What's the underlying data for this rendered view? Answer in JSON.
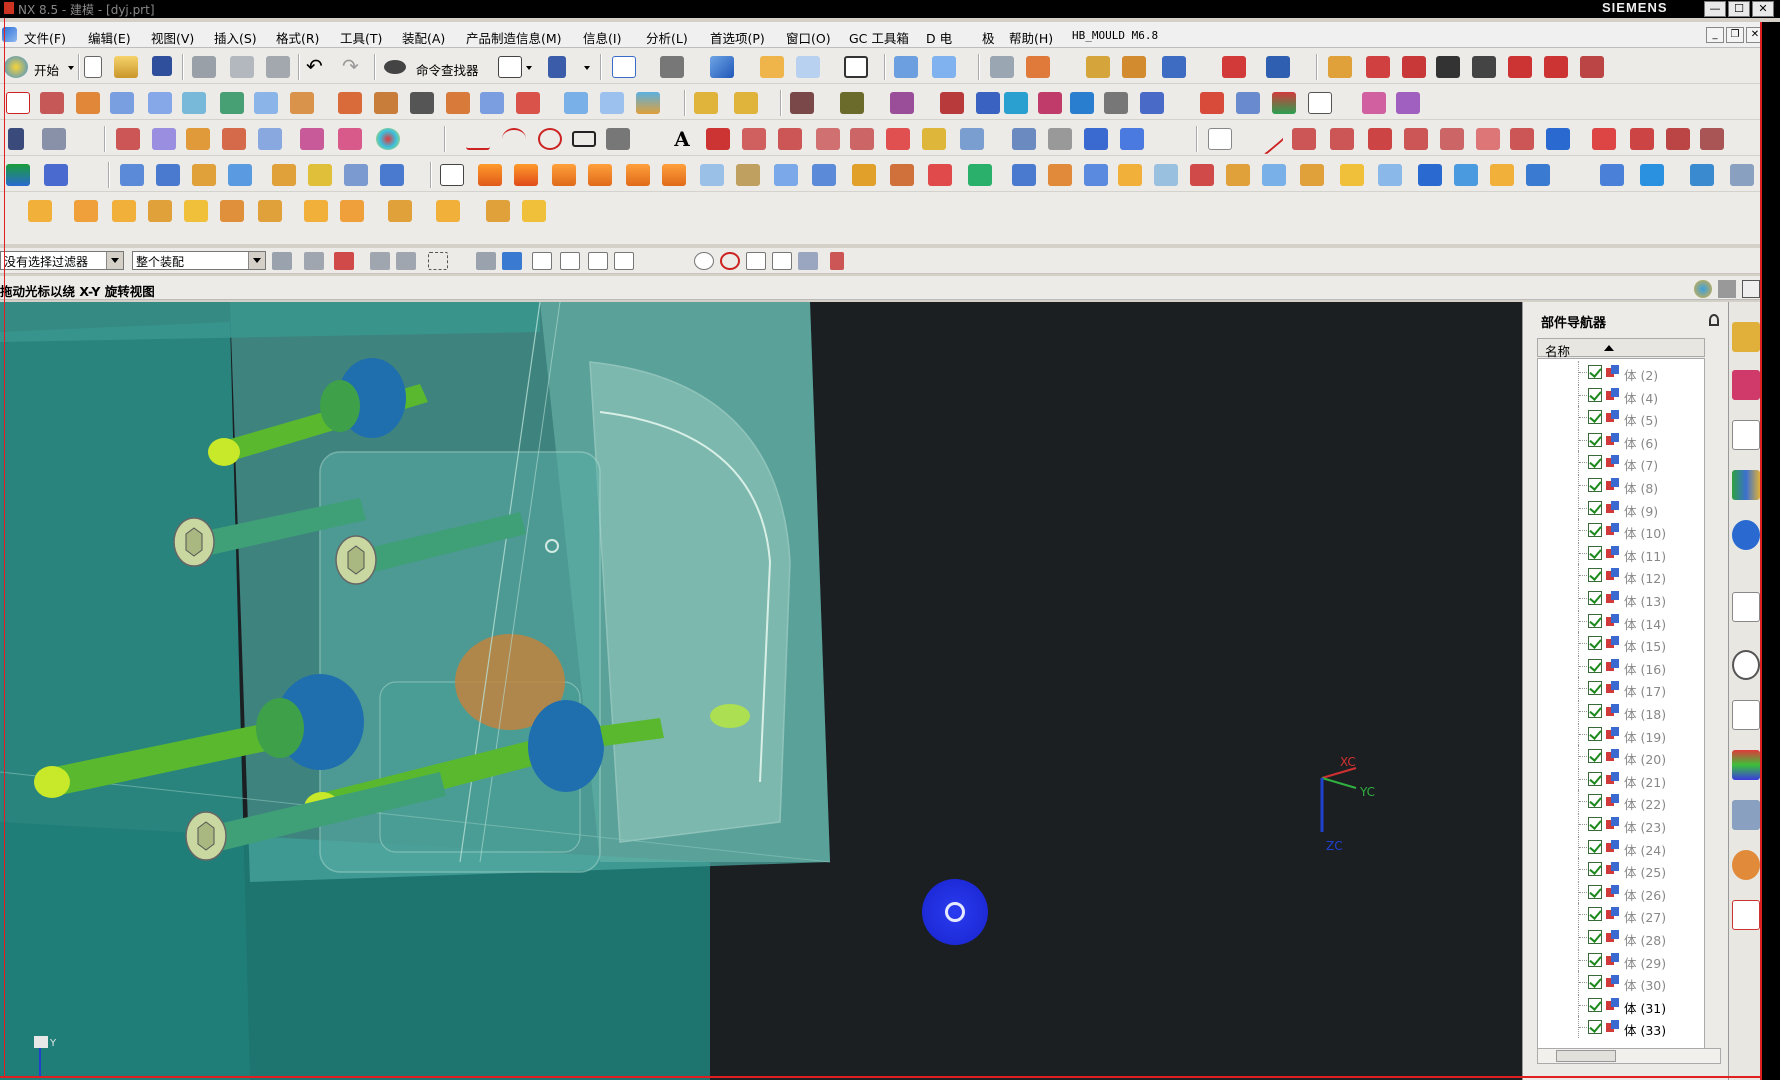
{
  "window": {
    "title": "NX 8.5 - 建模 - [dyj.prt]",
    "brand": "SIEMENS",
    "buttons": {
      "minimize": "—",
      "maximize": "☐",
      "close": "✕"
    }
  },
  "menubar": {
    "items": [
      "文件(F)",
      "编辑(E)",
      "视图(V)",
      "插入(S)",
      "格式(R)",
      "工具(T)",
      "装配(A)",
      "产品制造信息(M)",
      "信息(I)",
      "分析(L)",
      "首选项(P)",
      "窗口(O)",
      "GC 工具箱",
      "D 电",
      "极",
      "帮助(H)",
      "HB_MOULD M6.8"
    ],
    "mdi": {
      "minimize": "_",
      "restore": "❐",
      "close": "✕"
    }
  },
  "toolbar": {
    "start_label": "开始",
    "command_finder_label": "命令查找器"
  },
  "selection_bar": {
    "filter": "没有选择过滤器",
    "scope": "整个装配"
  },
  "cue_line": {
    "text": "拖动光标以绕 X-Y 旋转视图"
  },
  "viewport": {
    "background": "#1c1f22",
    "triad": {
      "x": "XC",
      "y": "YC",
      "z": "ZC"
    },
    "corner_axis": "Y"
  },
  "part_navigator": {
    "title": "部件导航器",
    "column_header": "名称",
    "rows": [
      {
        "label": "体 (2)",
        "active": false
      },
      {
        "label": "体 (4)",
        "active": false
      },
      {
        "label": "体 (5)",
        "active": false
      },
      {
        "label": "体 (6)",
        "active": false
      },
      {
        "label": "体 (7)",
        "active": false
      },
      {
        "label": "体 (8)",
        "active": false
      },
      {
        "label": "体 (9)",
        "active": false
      },
      {
        "label": "体 (10)",
        "active": false
      },
      {
        "label": "体 (11)",
        "active": false
      },
      {
        "label": "体 (12)",
        "active": false
      },
      {
        "label": "体 (13)",
        "active": false
      },
      {
        "label": "体 (14)",
        "active": false
      },
      {
        "label": "体 (15)",
        "active": false
      },
      {
        "label": "体 (16)",
        "active": false
      },
      {
        "label": "体 (17)",
        "active": false
      },
      {
        "label": "体 (18)",
        "active": false
      },
      {
        "label": "体 (19)",
        "active": false
      },
      {
        "label": "体 (20)",
        "active": false
      },
      {
        "label": "体 (21)",
        "active": false
      },
      {
        "label": "体 (22)",
        "active": false
      },
      {
        "label": "体 (23)",
        "active": false
      },
      {
        "label": "体 (24)",
        "active": false
      },
      {
        "label": "体 (25)",
        "active": false
      },
      {
        "label": "体 (26)",
        "active": false
      },
      {
        "label": "体 (27)",
        "active": false
      },
      {
        "label": "体 (28)",
        "active": false
      },
      {
        "label": "体 (29)",
        "active": false
      },
      {
        "label": "体 (30)",
        "active": false
      },
      {
        "label": "体 (31)",
        "active": true
      },
      {
        "label": "体 (33)",
        "active": true
      }
    ]
  },
  "colors": {
    "accent": "#2a3cf0",
    "mold_teal": "#2f8f86",
    "pin_green": "#5ab82f",
    "pin_tip": "#c8e82a",
    "bushing_blue": "#1f6fae"
  }
}
